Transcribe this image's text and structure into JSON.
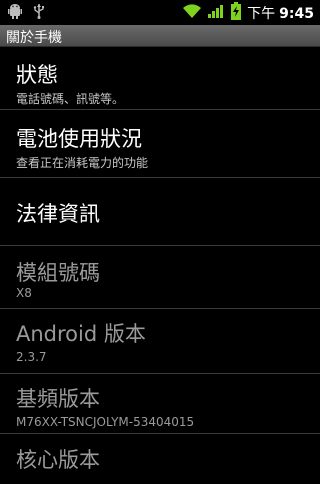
{
  "status_bar": {
    "ampm": "下午",
    "time": "9:45",
    "icons": [
      "android-debug-icon",
      "usb-icon",
      "wifi-icon",
      "signal-icon",
      "battery-charging-icon"
    ]
  },
  "title_bar": {
    "title": "關於手機"
  },
  "items": [
    {
      "title": "狀態",
      "summary": "電話號碼、訊號等。"
    },
    {
      "title": "電池使用狀況",
      "summary": "查看正在消耗電力的功能"
    },
    {
      "title": "法律資訊",
      "summary": ""
    },
    {
      "title": "模組號碼",
      "summary": "X8"
    },
    {
      "title": "Android 版本",
      "summary": "2.3.7"
    },
    {
      "title": "基頻版本",
      "summary": "M76XX-TSNCJOLYM-53404015"
    },
    {
      "title": "核心版本",
      "summary": ""
    }
  ],
  "colors": {
    "background": "#000000",
    "title_bar": "#5a5a5a",
    "wifi_signal_green": "#7ed321"
  }
}
